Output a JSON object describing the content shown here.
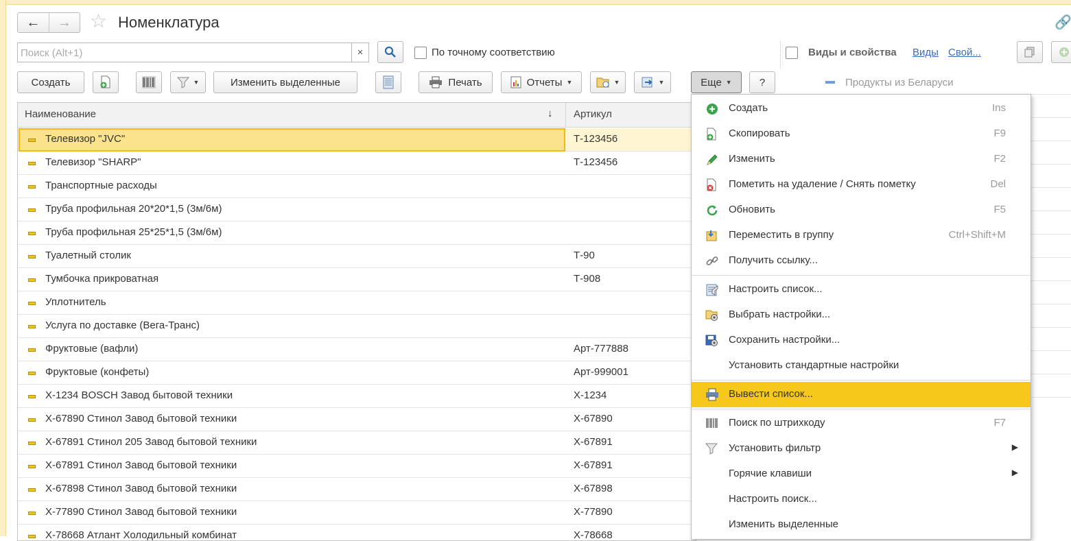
{
  "window": {
    "title": "Номенклатура"
  },
  "search": {
    "placeholder": "Поиск (Alt+1)",
    "clear": "×",
    "exact_label": "По точному соответствию"
  },
  "toolbar": {
    "create": "Создать",
    "edit_selected": "Изменить выделенные",
    "print": "Печать",
    "reports": "Отчеты",
    "more": "Еще",
    "help": "?"
  },
  "table": {
    "columns": [
      "Наименование",
      "Артикул"
    ],
    "sort_glyph": "↓",
    "rows": [
      {
        "name": "Телевизор \"JVC\"",
        "article": "Т-123456",
        "selected": true
      },
      {
        "name": "Телевизор \"SHARP\"",
        "article": "Т-123456"
      },
      {
        "name": "Транспортные расходы",
        "article": ""
      },
      {
        "name": "Труба профильная 20*20*1,5 (3м/6м)",
        "article": ""
      },
      {
        "name": "Труба профильная 25*25*1,5 (3м/6м)",
        "article": ""
      },
      {
        "name": "Туалетный столик",
        "article": "Т-90"
      },
      {
        "name": "Тумбочка прикроватная",
        "article": "Т-908"
      },
      {
        "name": "Уплотнитель",
        "article": ""
      },
      {
        "name": "Услуга по доставке (Вега-Транс)",
        "article": ""
      },
      {
        "name": "Фруктовые (вафли)",
        "article": "Арт-777888"
      },
      {
        "name": "Фруктовые (конфеты)",
        "article": "Арт-999001"
      },
      {
        "name": "Х-1234 BOSCH Завод бытовой техники",
        "article": "Х-1234"
      },
      {
        "name": "Х-67890 Стинол Завод бытовой техники",
        "article": "Х-67890"
      },
      {
        "name": "Х-67891 Стинол 205 Завод бытовой техники",
        "article": "Х-67891"
      },
      {
        "name": "Х-67891 Стинол Завод бытовой техники",
        "article": "Х-67891"
      },
      {
        "name": "Х-67898 Стинол Завод бытовой техники",
        "article": "Х-67898"
      },
      {
        "name": "Х-77890 Стинол Завод бытовой техники",
        "article": "Х-77890"
      },
      {
        "name": "Х-78668 Атлант Холодильный комбинат",
        "article": "Х-78668"
      }
    ]
  },
  "right_panel": {
    "header": "Виды и свойства",
    "link_types": "Виды",
    "link_props": "Свой...",
    "item": "Продукты из Беларуси"
  },
  "more_menu": {
    "items": [
      {
        "label": "Создать",
        "shortcut": "Ins",
        "icon": "create-icon"
      },
      {
        "label": "Скопировать",
        "shortcut": "F9",
        "icon": "copy-icon"
      },
      {
        "label": "Изменить",
        "shortcut": "F2",
        "icon": "edit-pencil-icon"
      },
      {
        "label": "Пометить на удаление / Снять пометку",
        "shortcut": "Del",
        "icon": "mark-delete-icon"
      },
      {
        "label": "Обновить",
        "shortcut": "F5",
        "icon": "refresh-icon"
      },
      {
        "label": "Переместить в группу",
        "shortcut": "Ctrl+Shift+M",
        "icon": "move-to-group-icon"
      },
      {
        "label": "Получить ссылку...",
        "shortcut": "",
        "icon": "link-icon"
      },
      {
        "label": "Настроить список...",
        "shortcut": "",
        "icon": "list-settings-icon"
      },
      {
        "label": "Выбрать настройки...",
        "shortcut": "",
        "icon": "choose-settings-icon"
      },
      {
        "label": "Сохранить настройки...",
        "shortcut": "",
        "icon": "save-settings-icon"
      },
      {
        "label": "Установить стандартные настройки",
        "shortcut": "",
        "icon": ""
      },
      {
        "label": "Вывести список...",
        "shortcut": "",
        "icon": "output-list-icon",
        "highlighted": true
      },
      {
        "label": "Поиск по штрихкоду",
        "shortcut": "F7",
        "icon": "barcode-icon"
      },
      {
        "label": "Установить фильтр",
        "shortcut": "",
        "icon": "filter-icon",
        "submenu": true
      },
      {
        "label": "Горячие клавиши",
        "shortcut": "",
        "icon": "",
        "submenu": true
      },
      {
        "label": "Настроить поиск...",
        "shortcut": "",
        "icon": ""
      },
      {
        "label": "Изменить выделенные",
        "shortcut": "",
        "icon": ""
      }
    ],
    "submenu_glyph": "▶"
  },
  "colors": {
    "selected_row": "#fbe38e",
    "menu_highlight": "#f7c81c",
    "link": "#3a6bb5"
  }
}
